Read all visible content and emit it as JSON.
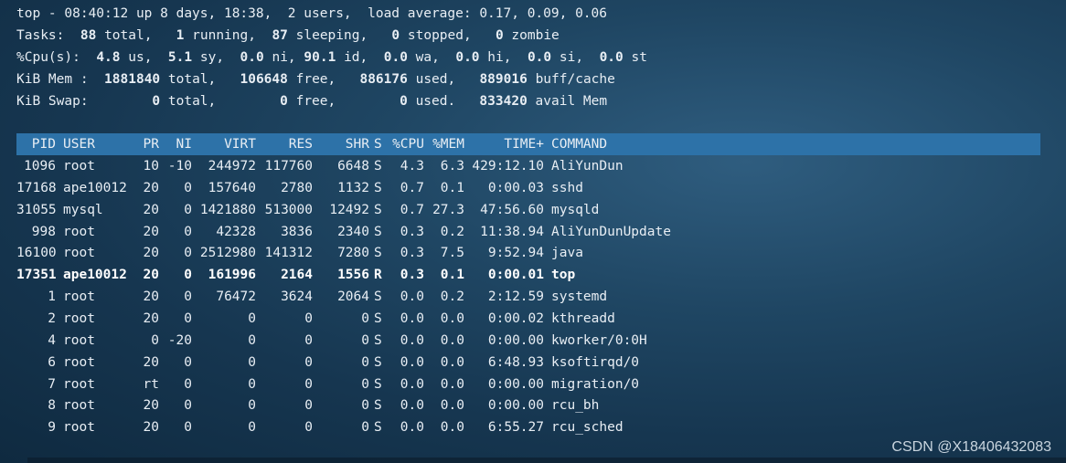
{
  "summary": {
    "uptime_line": "top - 08:40:12 up 8 days, 18:38,  2 users,  load average: 0.17, 0.09, 0.06",
    "tasks": {
      "label": "Tasks:",
      "total": "88",
      "total_lbl": "total,",
      "running": "1",
      "running_lbl": "running,",
      "sleeping": "87",
      "sleeping_lbl": "sleeping,",
      "stopped": "0",
      "stopped_lbl": "stopped,",
      "zombie": "0",
      "zombie_lbl": "zombie"
    },
    "cpu": {
      "label": "%Cpu(s):",
      "us": "4.8",
      "us_lbl": "us,",
      "sy": "5.1",
      "sy_lbl": "sy,",
      "ni": "0.0",
      "ni_lbl": "ni,",
      "id": "90.1",
      "id_lbl": "id,",
      "wa": "0.0",
      "wa_lbl": "wa,",
      "hi": "0.0",
      "hi_lbl": "hi,",
      "si": "0.0",
      "si_lbl": "si,",
      "st": "0.0",
      "st_lbl": "st"
    },
    "mem": {
      "label": "KiB Mem :",
      "total": "1881840",
      "total_lbl": "total,",
      "free": "106648",
      "free_lbl": "free,",
      "used": "886176",
      "used_lbl": "used,",
      "buff": "889016",
      "buff_lbl": "buff/cache"
    },
    "swap": {
      "label": "KiB Swap:",
      "total": "0",
      "total_lbl": "total,",
      "free": "0",
      "free_lbl": "free,",
      "used": "0",
      "used_lbl": "used.",
      "avail": "833420",
      "avail_lbl": "avail Mem"
    }
  },
  "columns": [
    "PID",
    "USER",
    "PR",
    "NI",
    "VIRT",
    "RES",
    "SHR",
    "S",
    "%CPU",
    "%MEM",
    "TIME+",
    "COMMAND"
  ],
  "processes": [
    {
      "pid": "1096",
      "user": "root",
      "pr": "10",
      "ni": "-10",
      "virt": "244972",
      "res": "117760",
      "shr": "6648",
      "s": "S",
      "cpu": "4.3",
      "mem": "6.3",
      "time": "429:12.10",
      "command": "AliYunDun"
    },
    {
      "pid": "17168",
      "user": "ape10012",
      "pr": "20",
      "ni": "0",
      "virt": "157640",
      "res": "2780",
      "shr": "1132",
      "s": "S",
      "cpu": "0.7",
      "mem": "0.1",
      "time": "0:00.03",
      "command": "sshd"
    },
    {
      "pid": "31055",
      "user": "mysql",
      "pr": "20",
      "ni": "0",
      "virt": "1421880",
      "res": "513000",
      "shr": "12492",
      "s": "S",
      "cpu": "0.7",
      "mem": "27.3",
      "time": "47:56.60",
      "command": "mysqld"
    },
    {
      "pid": "998",
      "user": "root",
      "pr": "20",
      "ni": "0",
      "virt": "42328",
      "res": "3836",
      "shr": "2340",
      "s": "S",
      "cpu": "0.3",
      "mem": "0.2",
      "time": "11:38.94",
      "command": "AliYunDunUpdate"
    },
    {
      "pid": "16100",
      "user": "root",
      "pr": "20",
      "ni": "0",
      "virt": "2512980",
      "res": "141312",
      "shr": "7280",
      "s": "S",
      "cpu": "0.3",
      "mem": "7.5",
      "time": "9:52.94",
      "command": "java"
    },
    {
      "pid": "17351",
      "user": "ape10012",
      "pr": "20",
      "ni": "0",
      "virt": "161996",
      "res": "2164",
      "shr": "1556",
      "s": "R",
      "cpu": "0.3",
      "mem": "0.1",
      "time": "0:00.01",
      "command": "top",
      "bold": true
    },
    {
      "pid": "1",
      "user": "root",
      "pr": "20",
      "ni": "0",
      "virt": "76472",
      "res": "3624",
      "shr": "2064",
      "s": "S",
      "cpu": "0.0",
      "mem": "0.2",
      "time": "2:12.59",
      "command": "systemd"
    },
    {
      "pid": "2",
      "user": "root",
      "pr": "20",
      "ni": "0",
      "virt": "0",
      "res": "0",
      "shr": "0",
      "s": "S",
      "cpu": "0.0",
      "mem": "0.0",
      "time": "0:00.02",
      "command": "kthreadd"
    },
    {
      "pid": "4",
      "user": "root",
      "pr": "0",
      "ni": "-20",
      "virt": "0",
      "res": "0",
      "shr": "0",
      "s": "S",
      "cpu": "0.0",
      "mem": "0.0",
      "time": "0:00.00",
      "command": "kworker/0:0H"
    },
    {
      "pid": "6",
      "user": "root",
      "pr": "20",
      "ni": "0",
      "virt": "0",
      "res": "0",
      "shr": "0",
      "s": "S",
      "cpu": "0.0",
      "mem": "0.0",
      "time": "6:48.93",
      "command": "ksoftirqd/0"
    },
    {
      "pid": "7",
      "user": "root",
      "pr": "rt",
      "ni": "0",
      "virt": "0",
      "res": "0",
      "shr": "0",
      "s": "S",
      "cpu": "0.0",
      "mem": "0.0",
      "time": "0:00.00",
      "command": "migration/0"
    },
    {
      "pid": "8",
      "user": "root",
      "pr": "20",
      "ni": "0",
      "virt": "0",
      "res": "0",
      "shr": "0",
      "s": "S",
      "cpu": "0.0",
      "mem": "0.0",
      "time": "0:00.00",
      "command": "rcu_bh"
    },
    {
      "pid": "9",
      "user": "root",
      "pr": "20",
      "ni": "0",
      "virt": "0",
      "res": "0",
      "shr": "0",
      "s": "S",
      "cpu": "0.0",
      "mem": "0.0",
      "time": "6:55.27",
      "command": "rcu_sched"
    }
  ],
  "watermark": "CSDN @X18406432083",
  "colors": {
    "header_bar": "#2d72a8",
    "background": "#1f4663",
    "text": "#e8eef4"
  }
}
